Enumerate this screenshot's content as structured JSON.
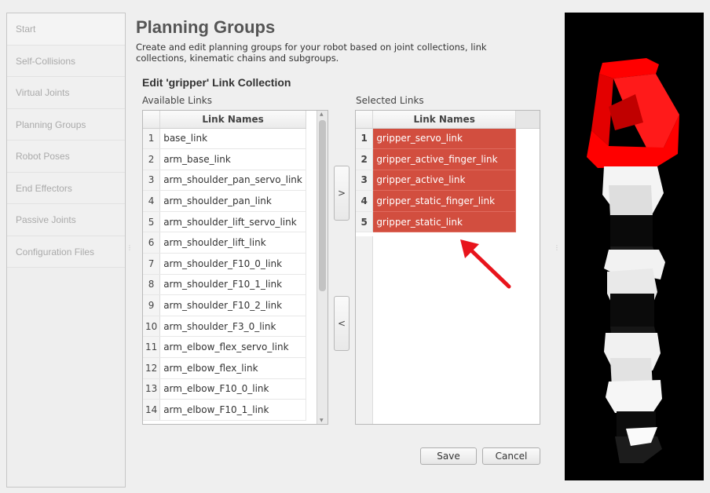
{
  "sidebar": {
    "items": [
      {
        "label": "Start"
      },
      {
        "label": "Self-Collisions"
      },
      {
        "label": "Virtual Joints"
      },
      {
        "label": "Planning Groups"
      },
      {
        "label": "Robot Poses"
      },
      {
        "label": "End Effectors"
      },
      {
        "label": "Passive Joints"
      },
      {
        "label": "Configuration Files"
      }
    ]
  },
  "header": {
    "title": "Planning Groups",
    "description": "Create and edit planning groups for your robot based on joint collections, link collections, kinematic chains and subgroups."
  },
  "editor": {
    "heading": "Edit 'gripper' Link Collection",
    "available_label": "Available Links",
    "selected_label": "Selected Links",
    "column_header": "Link Names",
    "add_label": ">",
    "remove_label": "<",
    "available_rows": [
      {
        "index": "1",
        "name": "base_link"
      },
      {
        "index": "2",
        "name": "arm_base_link"
      },
      {
        "index": "3",
        "name": "arm_shoulder_pan_servo_link"
      },
      {
        "index": "4",
        "name": "arm_shoulder_pan_link"
      },
      {
        "index": "5",
        "name": "arm_shoulder_lift_servo_link"
      },
      {
        "index": "6",
        "name": "arm_shoulder_lift_link"
      },
      {
        "index": "7",
        "name": "arm_shoulder_F10_0_link"
      },
      {
        "index": "8",
        "name": "arm_shoulder_F10_1_link"
      },
      {
        "index": "9",
        "name": "arm_shoulder_F10_2_link"
      },
      {
        "index": "10",
        "name": "arm_shoulder_F3_0_link"
      },
      {
        "index": "11",
        "name": "arm_elbow_flex_servo_link"
      },
      {
        "index": "12",
        "name": "arm_elbow_flex_link"
      },
      {
        "index": "13",
        "name": "arm_elbow_F10_0_link"
      },
      {
        "index": "14",
        "name": "arm_elbow_F10_1_link"
      }
    ],
    "selected_rows": [
      {
        "index": "1",
        "name": "gripper_servo_link"
      },
      {
        "index": "2",
        "name": "gripper_active_finger_link"
      },
      {
        "index": "3",
        "name": "gripper_active_link"
      },
      {
        "index": "4",
        "name": "gripper_static_finger_link"
      },
      {
        "index": "5",
        "name": "gripper_static_link"
      }
    ],
    "available_scroll_fraction": 0.0
  },
  "actions": {
    "save_label": "Save",
    "cancel_label": "Cancel"
  },
  "colors": {
    "selection": "#d24e3f",
    "annotation_arrow": "#e8141c",
    "gripper_highlight": "#ff0000"
  },
  "icons": [
    "scroll-up-arrow-icon",
    "scroll-down-arrow-icon",
    "annotation-arrow-icon"
  ]
}
